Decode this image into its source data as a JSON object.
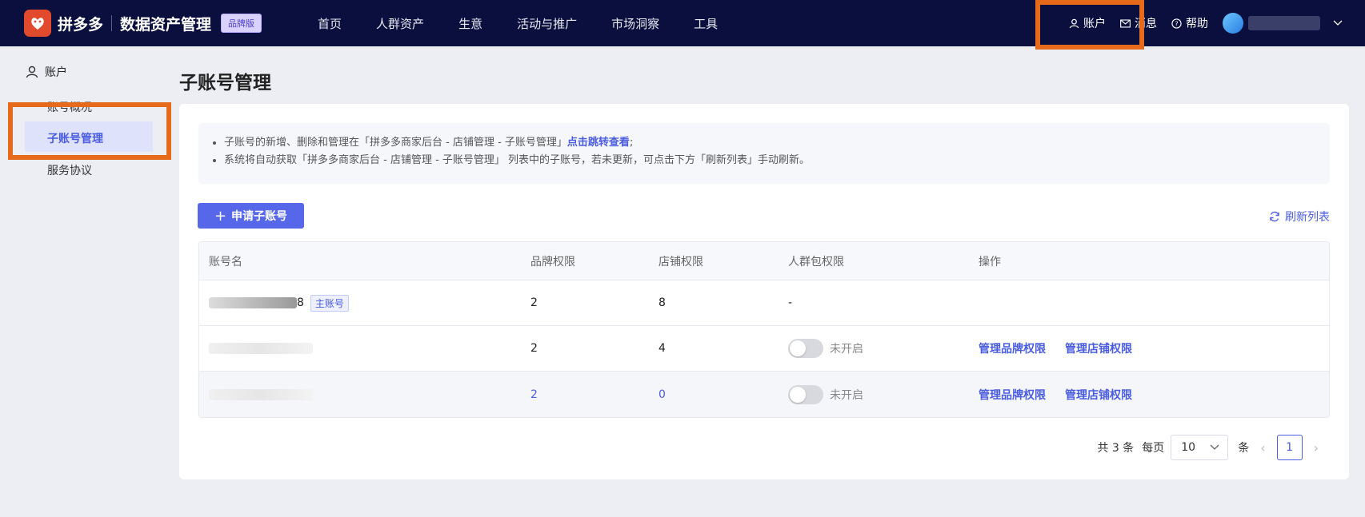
{
  "header": {
    "logo_text": "拼多多",
    "product": "数据资产管理",
    "edition_badge": "品牌版",
    "nav": [
      "首页",
      "人群资产",
      "生意",
      "活动与推广",
      "市场洞察",
      "工具"
    ],
    "account": "账户",
    "messages": "消息",
    "help": "帮助"
  },
  "sidebar": {
    "title": "账户",
    "items": [
      "账号概况",
      "子账号管理",
      "服务协议"
    ],
    "active": "子账号管理"
  },
  "page": {
    "title": "子账号管理",
    "notice_1_prefix": "子账号的新增、删除和管理在「拼多多商家后台 - 店铺管理 - 子账号管理」",
    "notice_1_link": "点击跳转查看",
    "notice_1_suffix": ";",
    "notice_2": "系统将自动获取「拼多多商家后台 - 店铺管理 - 子账号管理」 列表中的子账号，若未更新，可点击下方「刷新列表」手动刷新。",
    "apply_button": "申请子账号",
    "refresh_button": "刷新列表"
  },
  "table": {
    "columns": [
      "账号名",
      "品牌权限",
      "店铺权限",
      "人群包权限",
      "操作"
    ],
    "rows": [
      {
        "name_suffix": "8",
        "badge": "主账号",
        "brand": "2",
        "shop": "8",
        "crowd": "-"
      },
      {
        "brand": "2",
        "shop": "4",
        "toggle_label": "未开启",
        "op1": "管理品牌权限",
        "op2": "管理店铺权限"
      },
      {
        "brand": "2",
        "shop": "0",
        "toggle_label": "未开启",
        "op1": "管理品牌权限",
        "op2": "管理店铺权限"
      }
    ]
  },
  "pagination": {
    "total": "共 3 条",
    "per_page_label": "每页",
    "per_page": "10",
    "unit": "条",
    "current": "1"
  }
}
